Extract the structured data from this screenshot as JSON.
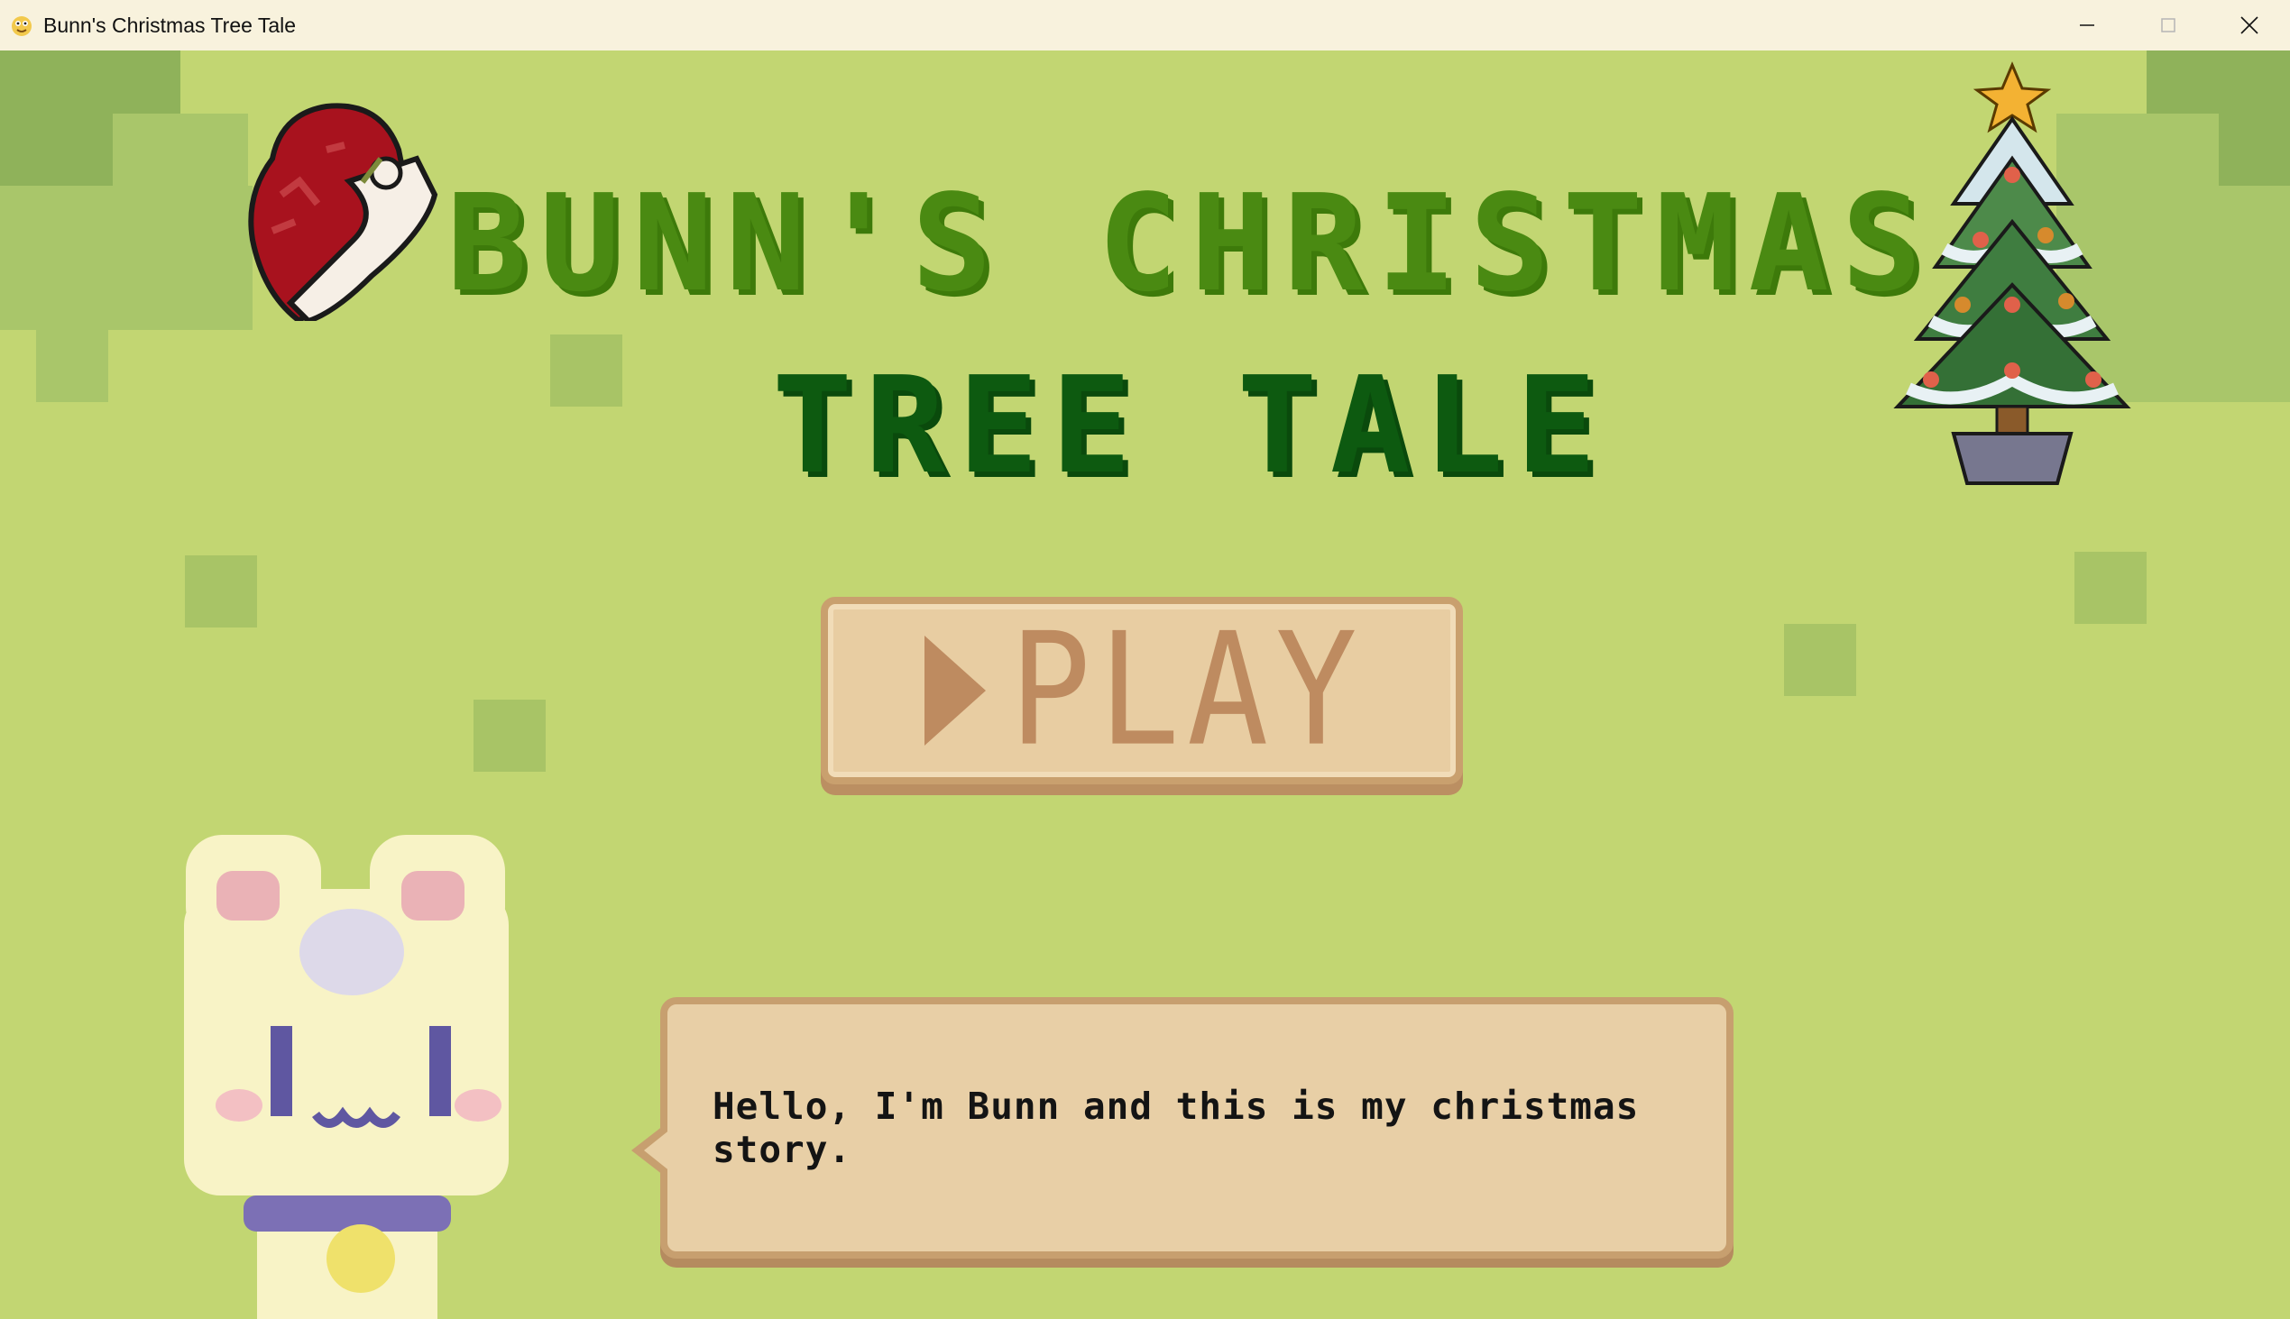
{
  "window": {
    "title": "Bunn's Christmas Tree Tale",
    "app_icon": "pygame-snake-icon",
    "controls": [
      "minimize-icon",
      "maximize-icon",
      "close-icon"
    ]
  },
  "game": {
    "title_line1": "Bunn's Christmas",
    "title_line2": "Tree Tale",
    "play_button_label": "PLAY",
    "play_icon": "play-triangle-icon",
    "speech_text": "Hello, I'm Bunn and this is my christmas story.",
    "decorations": [
      "santa-hat-icon",
      "christmas-tree-icon",
      "bunn-character"
    ],
    "colors": {
      "background": "#c2d672",
      "title_line1": "#4a8a12",
      "title_line2": "#0d5a10",
      "button_fill": "#e8cda2",
      "button_text": "#be8b60"
    }
  }
}
